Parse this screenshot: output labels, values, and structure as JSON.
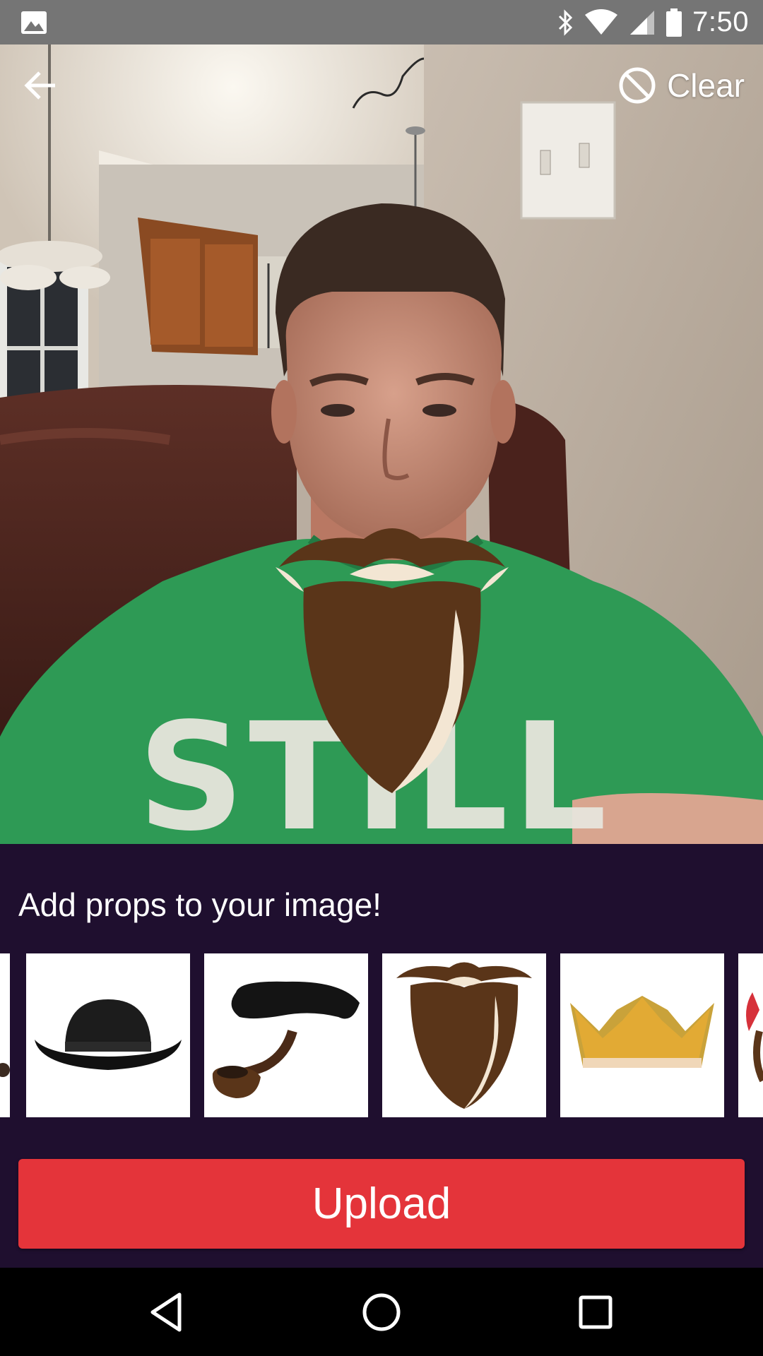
{
  "status_bar": {
    "time": "7:50",
    "icons": [
      "gallery-icon",
      "bluetooth-icon",
      "wifi-icon",
      "signal-icon",
      "battery-icon"
    ]
  },
  "toolbar": {
    "back_icon": "arrow-left-icon",
    "clear_label": "Clear",
    "clear_icon": "block-icon"
  },
  "photo": {
    "overlay_prop": "beard",
    "shirt_text": "STILL"
  },
  "props_panel": {
    "prompt": "Add props to your image!",
    "items": [
      "partial-prop",
      "bowler-hat",
      "pipe-mustache",
      "beard",
      "crown",
      "partial-prop"
    ]
  },
  "upload": {
    "label": "Upload"
  },
  "nav_bar": {
    "items": [
      "back-triangle-icon",
      "home-circle-icon",
      "recents-square-icon"
    ]
  },
  "colors": {
    "panel_bg": "#1f0f2f",
    "upload_bg": "#e4343a",
    "status_bg": "#757575",
    "shirt_green": "#2e9a55",
    "beard_brown": "#5a3519"
  }
}
